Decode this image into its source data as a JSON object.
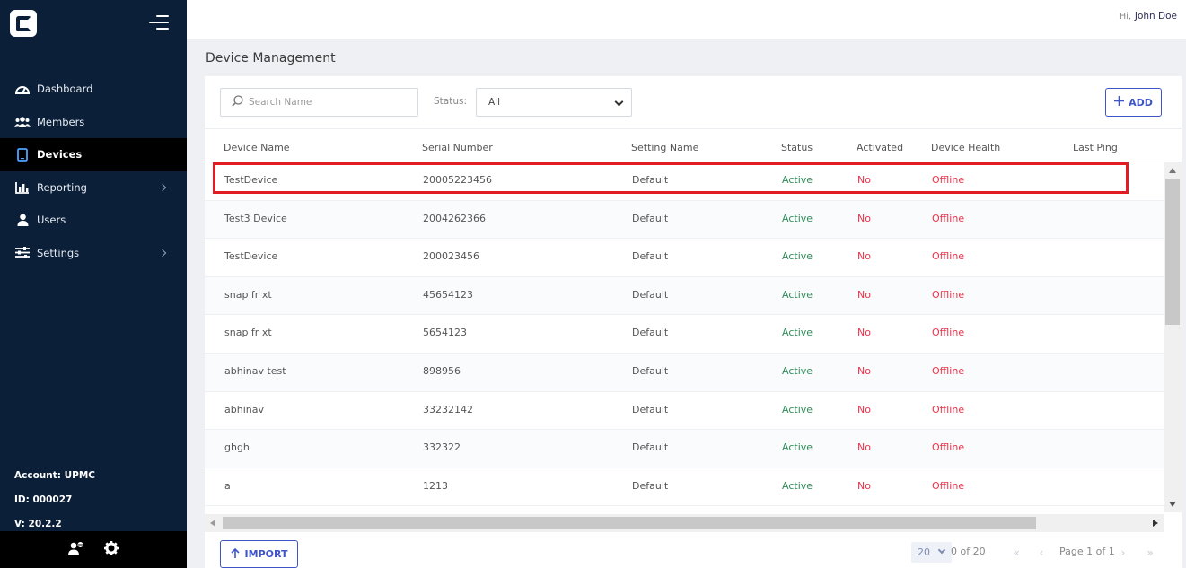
{
  "sidebar": {
    "items": [
      {
        "label": "Dashboard",
        "icon": "dashboard-icon"
      },
      {
        "label": "Members",
        "icon": "members-icon"
      },
      {
        "label": "Devices",
        "icon": "devices-icon",
        "active": true
      },
      {
        "label": "Reporting",
        "icon": "reporting-icon",
        "has_children": true
      },
      {
        "label": "Users",
        "icon": "user-icon"
      },
      {
        "label": "Settings",
        "icon": "settings-sliders-icon",
        "has_children": true
      }
    ],
    "account": "Account: UPMC",
    "id": "ID: 000027",
    "version": "V: 20.2.2"
  },
  "header": {
    "greeting": "Hi,",
    "user_name": "John Doe"
  },
  "page": {
    "title": "Device Management"
  },
  "toolbar": {
    "search_placeholder": "Search Name",
    "status_label": "Status:",
    "status_value": "All",
    "add_label": "ADD"
  },
  "table": {
    "columns": [
      "Device Name",
      "Serial Number",
      "Setting Name",
      "Status",
      "Activated",
      "Device Health",
      "Last Ping"
    ],
    "rows": [
      [
        "TestDevice",
        "20005223456",
        "Default",
        "Active",
        "No",
        "Offline",
        ""
      ],
      [
        "Test3 Device",
        "2004262366",
        "Default",
        "Active",
        "No",
        "Offline",
        ""
      ],
      [
        "TestDevice",
        "200023456",
        "Default",
        "Active",
        "No",
        "Offline",
        ""
      ],
      [
        "snap fr xt",
        "45654123",
        "Default",
        "Active",
        "No",
        "Offline",
        ""
      ],
      [
        "snap fr xt",
        "5654123",
        "Default",
        "Active",
        "No",
        "Offline",
        ""
      ],
      [
        "abhinav test",
        "898956",
        "Default",
        "Active",
        "No",
        "Offline",
        ""
      ],
      [
        "abhinav",
        "33232142",
        "Default",
        "Active",
        "No",
        "Offline",
        ""
      ],
      [
        "ghgh",
        "332322",
        "Default",
        "Active",
        "No",
        "Offline",
        ""
      ],
      [
        "a",
        "1213",
        "Default",
        "Active",
        "No",
        "Offline",
        ""
      ]
    ]
  },
  "footer": {
    "import_label": "IMPORT",
    "page_size": "20",
    "range_text": "0 of 20",
    "page_info": "Page 1 of 1"
  },
  "colors": {
    "sidebar_bg": "#0b1f38",
    "accent": "#3f55c7",
    "active_green": "#2e8b57",
    "alert_red": "#e8334a",
    "highlight_red": "#e31b23"
  }
}
